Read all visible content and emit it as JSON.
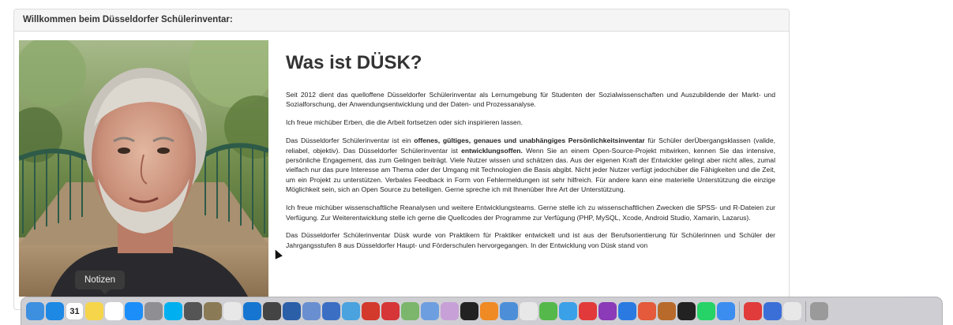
{
  "panel": {
    "heading": "Willkommen beim Düsseldorfer Schülerinventar:"
  },
  "content": {
    "title": "Was ist DÜSK?",
    "p1": "Seit 2012 dient das quelloffene Düsseldorfer Schülerinventar als Lernumgebung für Studenten der Sozialwissenschaften und Auszubildende der Markt- und Sozialforschung, der Anwendungsentwicklung und der Daten- und Prozessanalyse.",
    "p2": "Ich freue michüber Erben, die die Arbeit fortsetzen oder sich inspirieren lassen.",
    "p3a": "Das Düsseldorfer Schülerinventar ist ein ",
    "p3b": "offenes, gültiges, genaues und unabhängiges Persönlichkeitsinventar",
    "p3c": " für Schüler derÜbergangsklassen (valide, reliabel, objektiv). Das Düsseldorfer Schülerinventar ist ",
    "p3d": "entwicklungsoffen.",
    "p3e": " Wenn Sie an einem Open-Source-Projekt mitwirken, kennen Sie das intensive, persönliche Engagement, das zum Gelingen beiträgt. Viele Nutzer wissen und schätzen das. Aus der eigenen Kraft der Entwickler gelingt aber nicht alles, zumal vielfach nur das pure Interesse am Thema oder der Umgang mit Technologien die Basis abgibt. Nicht jeder Nutzer verfügt jedochüber die Fähigkeiten und die Zeit, um ein Projekt zu unterstützen. Verbales Feedback in Form von Fehlermeldungen ist sehr hilfreich. Für andere kann eine materielle Unterstützung die einzige Möglichkeit sein, sich an Open Source zu beteiligen. Gerne spreche ich mit Ihnenüber Ihre Art der Unterstützung.",
    "p4": "Ich freue michüber wissenschaftliche Reanalysen und weitere Entwicklungsteams. Gerne stelle ich zu wissenschaftlichen Zwecken die SPSS- und R-Dateien zur Verfügung. Zur Weiterentwicklung stelle ich gerne die Quellcodes der Programme zur Verfügung (PHP, MySQL, Xcode, Android Studio, Xamarin, Lazarus).",
    "p5": "Das Düsseldorfer Schülerinventar Düsk wurde von Praktikern für Praktiker entwickelt und ist aus der Berufsorientierung für Schülerinnen und Schüler der Jahrgangsstufen 8 aus Düsseldorfer Haupt- und Förderschulen hervorgegangen. In der Entwicklung von Düsk stand von"
  },
  "tooltip": "Notizen",
  "dock": {
    "calendar_day": "31",
    "icons": [
      {
        "name": "finder-icon",
        "color": "#3d8fe0"
      },
      {
        "name": "safari-icon",
        "color": "#1e88e5"
      },
      {
        "name": "calendar-icon",
        "color": "#ffffff"
      },
      {
        "name": "notes-icon",
        "color": "#f7d54a"
      },
      {
        "name": "reminders-icon",
        "color": "#ffffff"
      },
      {
        "name": "app-store-icon",
        "color": "#1c8ef9"
      },
      {
        "name": "system-preferences-icon",
        "color": "#8e8e93"
      },
      {
        "name": "skype-icon",
        "color": "#00aff0"
      },
      {
        "name": "calculator-icon",
        "color": "#555555"
      },
      {
        "name": "gimp-icon",
        "color": "#8a7a55"
      },
      {
        "name": "textedit-icon",
        "color": "#e8e8e8"
      },
      {
        "name": "xcode-icon",
        "color": "#1575d1"
      },
      {
        "name": "chess-icon",
        "color": "#444444"
      },
      {
        "name": "instruments-icon",
        "color": "#2b5fa8"
      },
      {
        "name": "r-icon",
        "color": "#6a8fd0"
      },
      {
        "name": "lazarus-icon",
        "color": "#3b6fc4"
      },
      {
        "name": "lw-icon",
        "color": "#4aa3df"
      },
      {
        "name": "navicat-icon",
        "color": "#d33a2c"
      },
      {
        "name": "ewm-icon",
        "color": "#d63638"
      },
      {
        "name": "photo-icon",
        "color": "#7bb66c"
      },
      {
        "name": "settings-gear-icon",
        "color": "#6d9ee0"
      },
      {
        "name": "mail-icon",
        "color": "#c8a0d8"
      },
      {
        "name": "terminal-icon",
        "color": "#222222"
      },
      {
        "name": "books-icon",
        "color": "#f08a24"
      },
      {
        "name": "preview-icon",
        "color": "#4c8fd8"
      },
      {
        "name": "chrome-icon",
        "color": "#e8e8e8"
      },
      {
        "name": "activity-monitor-icon",
        "color": "#55b84a"
      },
      {
        "name": "files-icon",
        "color": "#3aa0e8"
      },
      {
        "name": "opera-icon",
        "color": "#e23a3a"
      },
      {
        "name": "headphones-icon",
        "color": "#8b3ab8"
      },
      {
        "name": "play-icon",
        "color": "#2a7ae2"
      },
      {
        "name": "photo-booth-icon",
        "color": "#e45a3a"
      },
      {
        "name": "library-icon",
        "color": "#b86a2a"
      },
      {
        "name": "kindle-icon",
        "color": "#222222"
      },
      {
        "name": "whatsapp-icon",
        "color": "#25d366"
      },
      {
        "name": "messages-icon",
        "color": "#3b8df0"
      }
    ],
    "icons_right": [
      {
        "name": "pdf-icon",
        "color": "#e13b3b"
      },
      {
        "name": "migration-icon",
        "color": "#3a6fd8"
      },
      {
        "name": "quicktime-icon",
        "color": "#e8e8e8"
      }
    ],
    "trash": {
      "name": "trash-icon",
      "color": "#9a9a9a"
    }
  }
}
